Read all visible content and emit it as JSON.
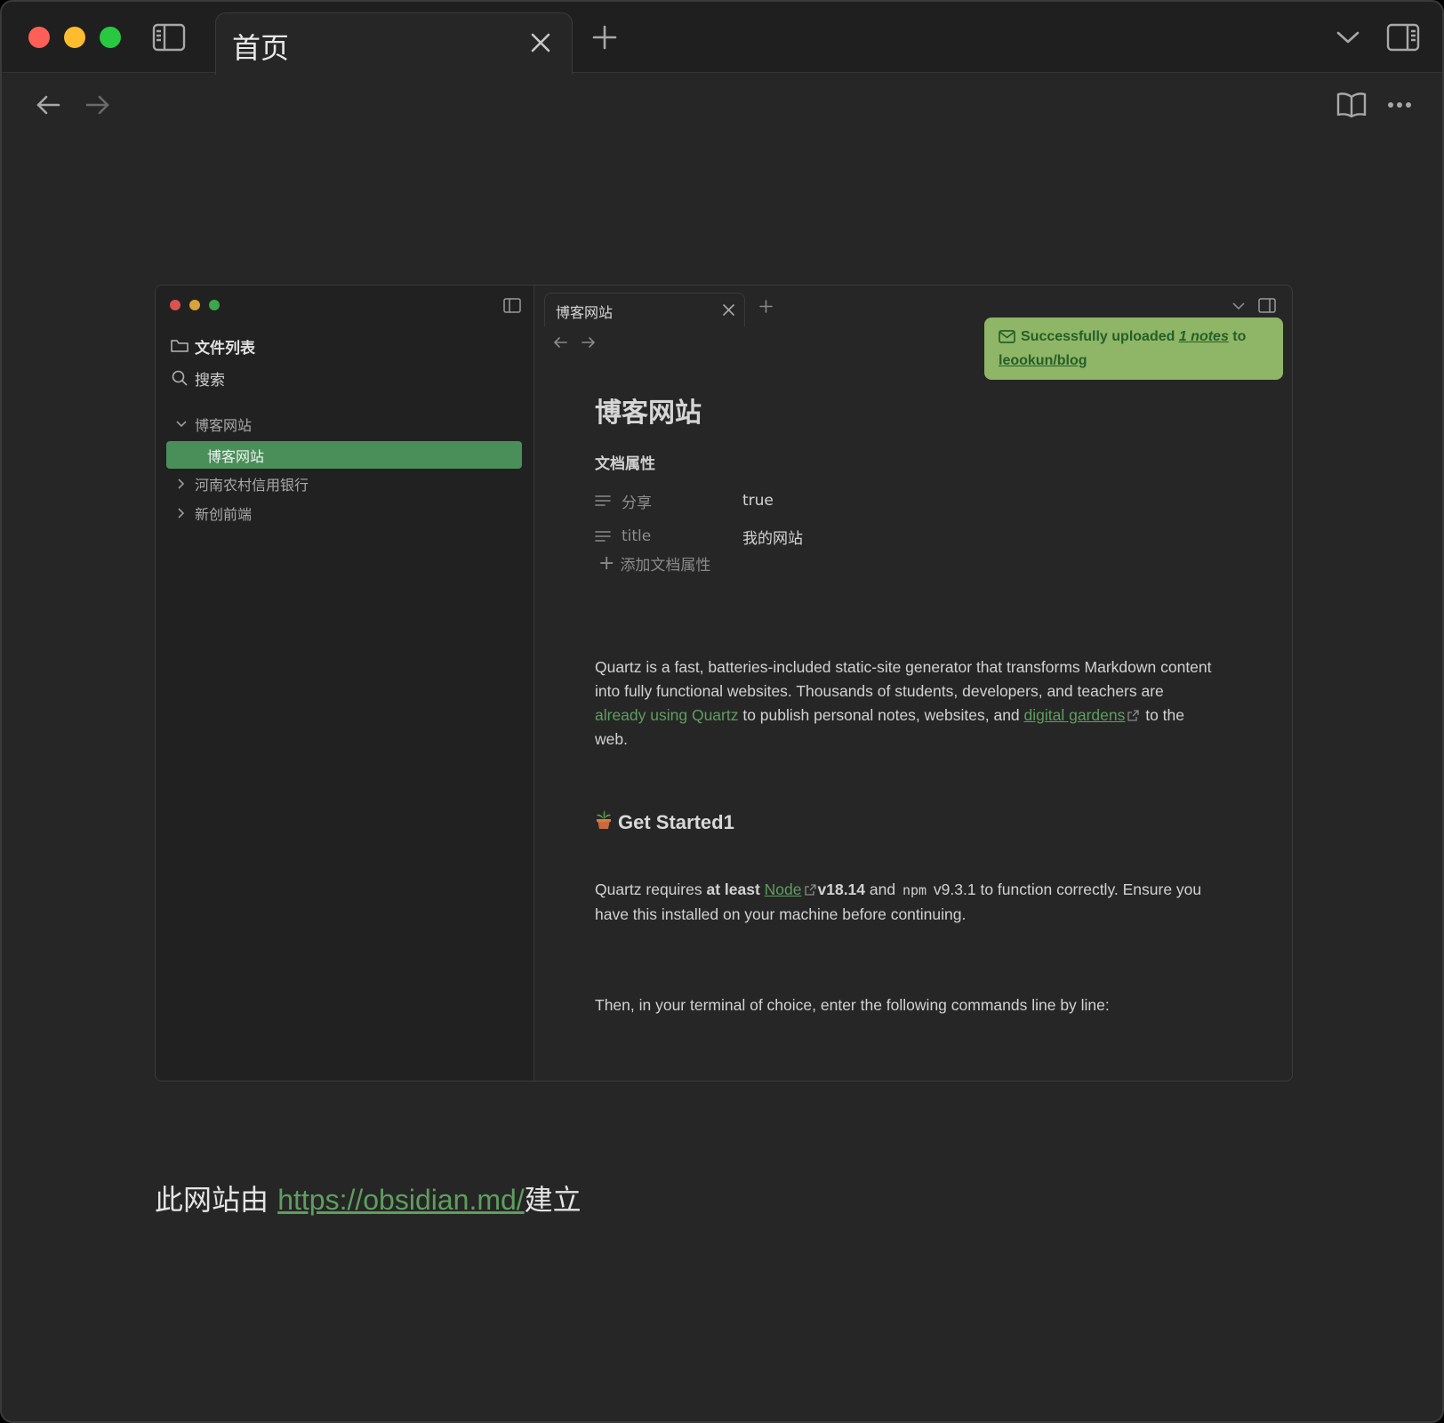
{
  "window": {
    "tab_title": "首页",
    "icons": [
      "sidebar-toggle-icon",
      "close-icon",
      "plus-icon",
      "chevron-down-icon",
      "right-sidebar-icon",
      "arrow-left-icon",
      "arrow-right-icon",
      "book-icon",
      "more-icon"
    ]
  },
  "inner": {
    "sidebar": {
      "file_list_label": "文件列表",
      "search_label": "搜索",
      "tree": [
        {
          "label": "博客网站",
          "expanded": true
        },
        {
          "label": "博客网站",
          "active": true
        },
        {
          "label": "河南农村信用银行",
          "expanded": false
        },
        {
          "label": "新创前端",
          "expanded": false
        }
      ]
    },
    "tab_title": "博客网站",
    "notice": {
      "prefix": "Successfully uploaded ",
      "count_link": "1 notes",
      "middle": " to ",
      "repo_link": "leookun/blog"
    },
    "doc": {
      "title": "博客网站",
      "properties_heading": "文档属性",
      "properties": [
        {
          "key": "分享",
          "value": "true"
        },
        {
          "key": "title",
          "value": "我的网站"
        }
      ],
      "add_property": "添加文档属性",
      "para1": {
        "t1": "Quartz is a fast, batteries-included static-site generator that transforms Markdown content into fully functional websites. Thousands of students, developers, and teachers are ",
        "link1": "already using Quartz",
        "t2": " to publish personal notes, websites, and ",
        "link2": "digital gardens",
        "t3": " to the web."
      },
      "heading2": "Get Started1",
      "para2": {
        "t1": "Quartz requires ",
        "bold1": "at least",
        "link": "Node",
        "bold2": "v18.14",
        "t2": " and ",
        "code": "npm",
        "t3": " v9.3.1 to function correctly. Ensure you have this installed on your machine before continuing."
      },
      "para3": "Then, in your terminal of choice, enter the following commands line by line:"
    }
  },
  "footer": {
    "prefix": "此网站由 ",
    "url": "https://obsidian.md/",
    "suffix": "建立"
  },
  "colors": {
    "accent_green": "#4a8f5a",
    "link_green": "#5e9e5e",
    "notice_bg": "#8fb566"
  }
}
